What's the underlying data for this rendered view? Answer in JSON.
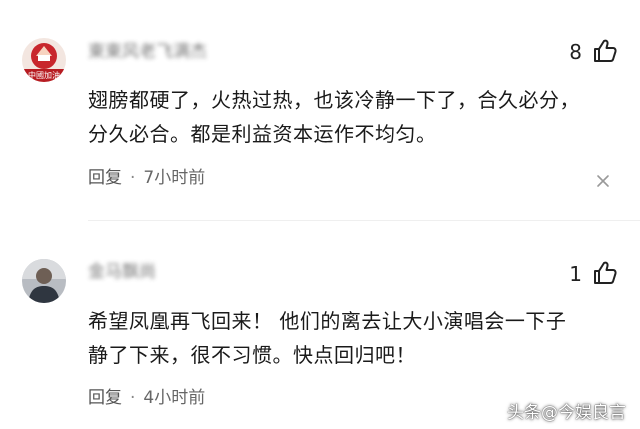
{
  "comments": [
    {
      "username": "東東风老飞满杰",
      "likes": "8",
      "text_line1": "翅膀都硬了，火热过热，也该冷静一下了，合久必分，",
      "text_line2": "分久必合。都是利益资本运作不均匀。",
      "reply_label": "回复",
      "separator": "·",
      "time": "7小时前",
      "avatar_caption": "中國加油"
    },
    {
      "username": "金马飘尚",
      "likes": "1",
      "text_line1": "希望凤凰再飞回来！ 他们的离去让大小演唱会一下子",
      "text_line2": "静了下来，很不习惯。快点回归吧！",
      "reply_label": "回复",
      "separator": "·",
      "time": "4小时前"
    }
  ],
  "watermark": "头条@今娱良言",
  "colors": {
    "text_primary": "#1a1a1a",
    "text_meta": "#666666",
    "avatar_red": "#c8262c"
  },
  "icons": [
    "thumbs-up-icon",
    "close-icon"
  ]
}
